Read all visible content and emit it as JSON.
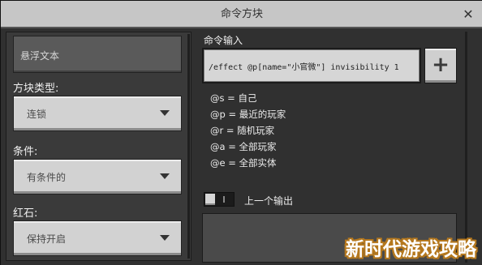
{
  "window": {
    "title": "命令方块",
    "close_label": "✕"
  },
  "left_panel": {
    "hover_text_placeholder": "悬浮文本",
    "block_type": {
      "label": "方块类型:",
      "value": "连锁"
    },
    "condition": {
      "label": "条件:",
      "value": "有条件的"
    },
    "redstone": {
      "label": "红石:",
      "value": "保持开启"
    }
  },
  "right_panel": {
    "command_input_label": "命令输入",
    "command_value": "/effect @p[name=\"小官微\"] invisibility 1",
    "add_button_label": "+",
    "selectors": [
      "@s = 自己",
      "@p = 最近的玩家",
      "@r = 随机玩家",
      "@a = 全部玩家",
      "@e = 全部实体"
    ],
    "previous_output": {
      "label": "上一个输出",
      "enabled": false
    }
  },
  "watermark": "新时代游戏攻略"
}
